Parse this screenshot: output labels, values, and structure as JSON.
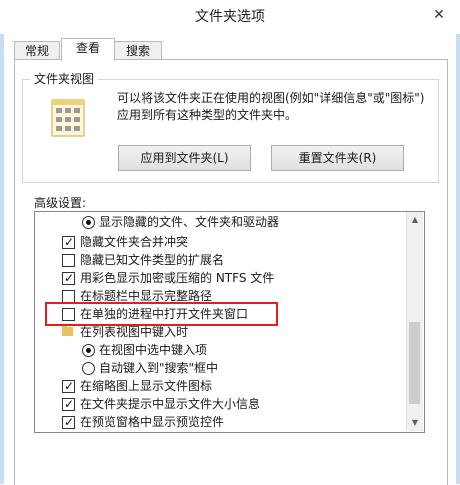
{
  "window": {
    "title": "文件夹选项",
    "close_glyph": "✕"
  },
  "tabs": [
    {
      "label": "常规",
      "active": false
    },
    {
      "label": "查看",
      "active": true
    },
    {
      "label": "搜索",
      "active": false
    }
  ],
  "folder_views": {
    "caption": "文件夹视图",
    "description": "可以将该文件夹正在使用的视图(例如\"详细信息\"或\"图标\")应用到所有这种类型的文件夹中。",
    "apply_button": "应用到文件夹(L)",
    "reset_button": "重置文件夹(R)",
    "icon": "folder-view-icon"
  },
  "advanced": {
    "label": "高级设置:",
    "items": [
      {
        "type": "radio",
        "checked": true,
        "indent": 2,
        "label": "显示隐藏的文件、文件夹和驱动器"
      },
      {
        "type": "checkbox",
        "checked": true,
        "indent": 1,
        "label": "隐藏文件夹合并冲突"
      },
      {
        "type": "checkbox",
        "checked": false,
        "indent": 1,
        "label": "隐藏已知文件类型的扩展名"
      },
      {
        "type": "checkbox",
        "checked": true,
        "indent": 1,
        "label": "用彩色显示加密或压缩的 NTFS 文件"
      },
      {
        "type": "checkbox",
        "checked": false,
        "indent": 1,
        "label": "在标题栏中显示完整路径"
      },
      {
        "type": "checkbox",
        "checked": false,
        "indent": 1,
        "label": "在单独的进程中打开文件夹窗口",
        "highlighted": true
      },
      {
        "type": "folder",
        "checked": false,
        "indent": 1,
        "label": "在列表视图中键入时"
      },
      {
        "type": "radio",
        "checked": true,
        "indent": 2,
        "label": "在视图中选中键入项"
      },
      {
        "type": "radio",
        "checked": false,
        "indent": 2,
        "label": "自动键入到\"搜索\"框中"
      },
      {
        "type": "checkbox",
        "checked": true,
        "indent": 1,
        "label": "在缩略图上显示文件图标"
      },
      {
        "type": "checkbox",
        "checked": true,
        "indent": 1,
        "label": "在文件夹提示中显示文件大小信息"
      },
      {
        "type": "checkbox",
        "checked": true,
        "indent": 1,
        "label": "在预览窗格中显示预览控件"
      }
    ],
    "scroll_up_glyph": "▲",
    "scroll_down_glyph": "▼",
    "check_glyph": "✓"
  },
  "colors": {
    "highlight": "#e02020",
    "accent_border": "#c8dcf2"
  }
}
